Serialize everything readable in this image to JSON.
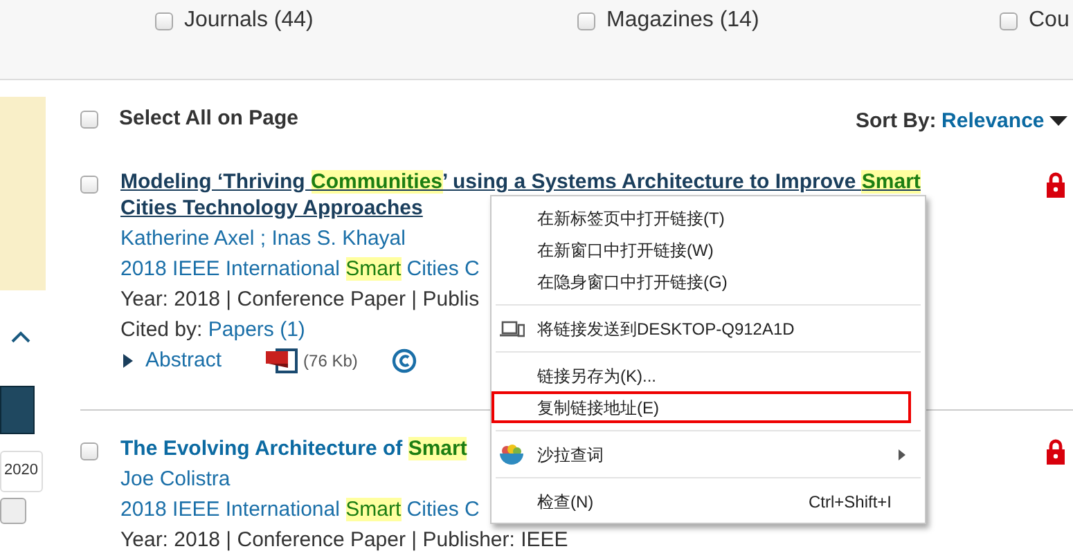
{
  "filters": [
    {
      "label": "Journals (44)",
      "checked": false
    },
    {
      "label": "Magazines (14)",
      "checked": false
    },
    {
      "label": "Cou",
      "checked": false
    }
  ],
  "select_all": {
    "label": "Select All on Page",
    "checked": false
  },
  "sort": {
    "label": "Sort By:",
    "value": "Relevance"
  },
  "sidebar": {
    "year_field": "2020"
  },
  "results": [
    {
      "checked": false,
      "underlined": true,
      "locked": true,
      "title": [
        {
          "text": "Modeling  ‘Thriving ",
          "highlight": false
        },
        {
          "text": "Communities",
          "highlight": true
        },
        {
          "text": "’  using a Systems Architecture to Improve ",
          "highlight": false
        },
        {
          "text": "Smart",
          "highlight": true
        },
        {
          "text": " Cities Technology Approaches",
          "highlight": false
        }
      ],
      "authors": "Katherine Axel ; Inas S. Khayal",
      "venue": [
        {
          "text": "2018 IEEE International ",
          "highlight": false
        },
        {
          "text": "Smart",
          "highlight": true
        },
        {
          "text": " Cities C",
          "highlight": false
        }
      ],
      "meta": "Year: 2018 | Conference Paper | Publis",
      "cited_label": "Cited by:",
      "cited_link": "Papers (1)",
      "abstract": "Abstract",
      "pdf_size": "(76 Kb)"
    },
    {
      "checked": false,
      "underlined": false,
      "locked": true,
      "title": [
        {
          "text": "The Evolving Architecture of ",
          "highlight": false
        },
        {
          "text": "Smart",
          "highlight": true
        }
      ],
      "authors": "Joe Colistra",
      "venue": [
        {
          "text": "2018 IEEE International ",
          "highlight": false
        },
        {
          "text": "Smart",
          "highlight": true
        },
        {
          "text": " Cities C",
          "highlight": false
        }
      ],
      "meta": "Year: 2018 | Conference Paper | Publisher: IEEE"
    }
  ],
  "context_menu": {
    "items": [
      {
        "kind": "item",
        "label": "在新标签页中打开链接(T)",
        "outlined": false
      },
      {
        "kind": "item",
        "label": "在新窗口中打开链接(W)",
        "outlined": false
      },
      {
        "kind": "item",
        "label": "在隐身窗口中打开链接(G)",
        "outlined": false
      },
      {
        "kind": "separator"
      },
      {
        "kind": "device",
        "label": "将链接发送到DESKTOP-Q912A1D",
        "outlined": false
      },
      {
        "kind": "separator"
      },
      {
        "kind": "item",
        "label": "链接另存为(K)...",
        "outlined": false
      },
      {
        "kind": "item",
        "label": "复制链接地址(E)",
        "outlined": true
      },
      {
        "kind": "separator"
      },
      {
        "kind": "submenu",
        "label": "沙拉查词",
        "outlined": false
      },
      {
        "kind": "separator"
      },
      {
        "kind": "item",
        "label": "检查(N)",
        "shortcut": "Ctrl+Shift+I",
        "outlined": false
      }
    ]
  }
}
